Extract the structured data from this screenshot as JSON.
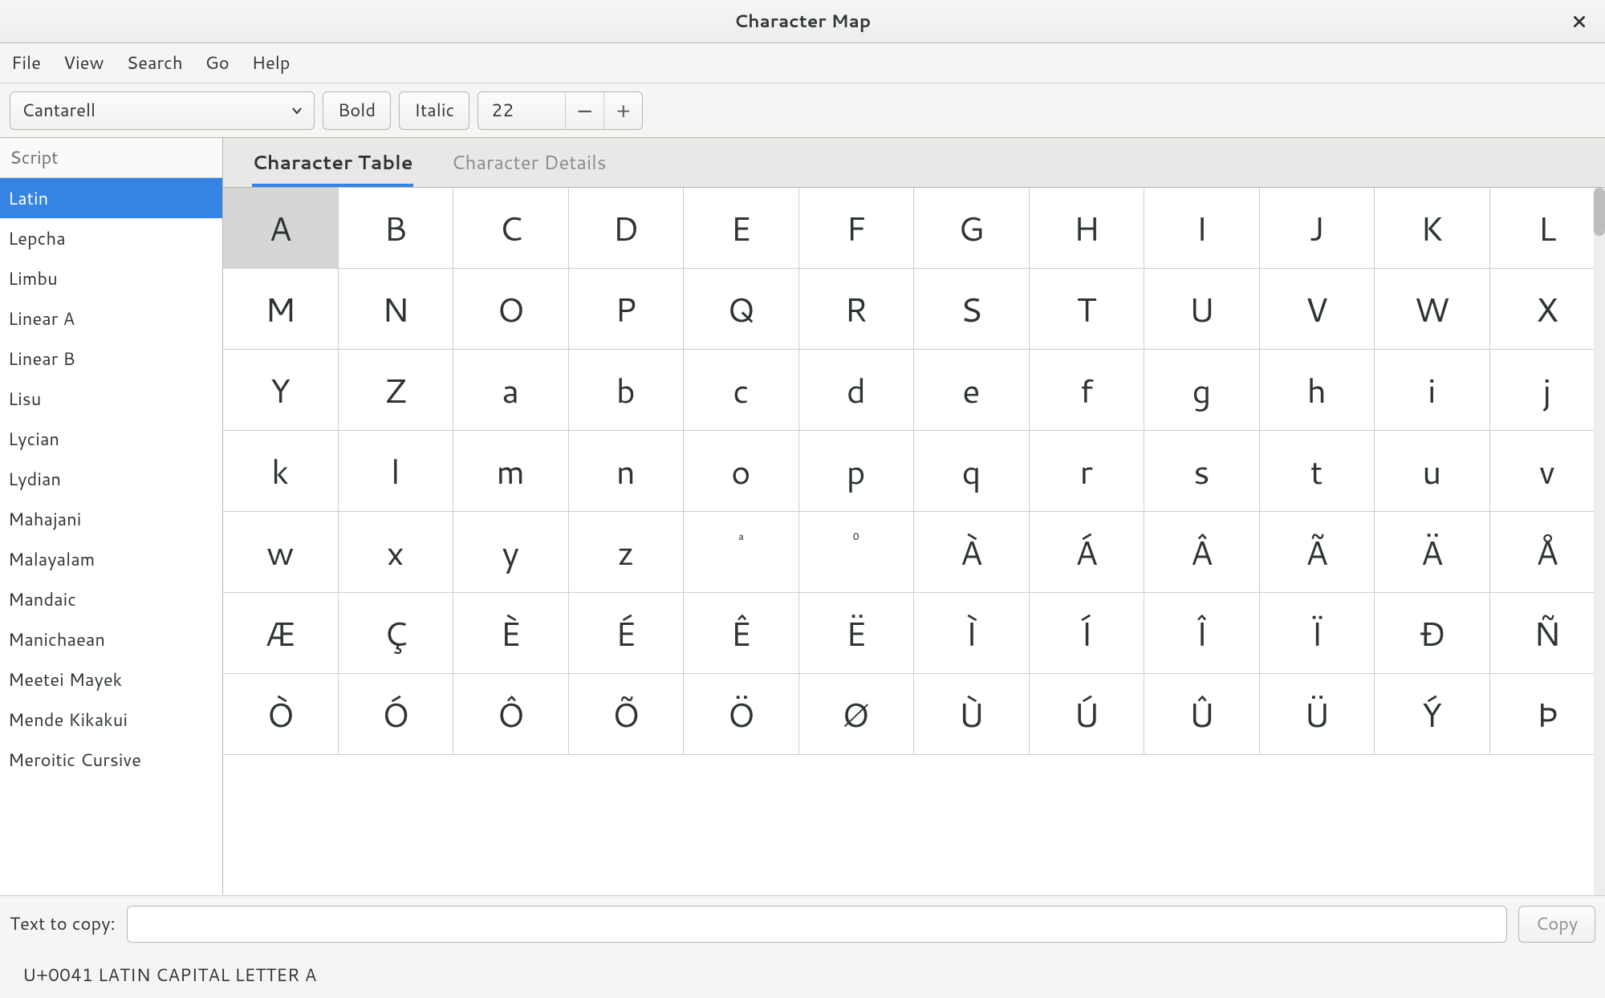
{
  "window": {
    "title": "Character Map"
  },
  "menubar": {
    "items": [
      "File",
      "View",
      "Search",
      "Go",
      "Help"
    ]
  },
  "toolbar": {
    "font": "Cantarell",
    "bold_label": "Bold",
    "italic_label": "Italic",
    "size": "22"
  },
  "sidebar": {
    "header": "Script",
    "selected_index": 0,
    "items": [
      "Latin",
      "Lepcha",
      "Limbu",
      "Linear A",
      "Linear B",
      "Lisu",
      "Lycian",
      "Lydian",
      "Mahajani",
      "Malayalam",
      "Mandaic",
      "Manichaean",
      "Meetei Mayek",
      "Mende Kikakui",
      "Meroitic Cursive"
    ]
  },
  "tabs": {
    "active": 0,
    "labels": [
      "Character Table",
      "Character Details"
    ]
  },
  "grid": {
    "selected_index": 0,
    "cells": [
      "A",
      "B",
      "C",
      "D",
      "E",
      "F",
      "G",
      "H",
      "I",
      "J",
      "K",
      "L",
      "M",
      "N",
      "O",
      "P",
      "Q",
      "R",
      "S",
      "T",
      "U",
      "V",
      "W",
      "X",
      "Y",
      "Z",
      "a",
      "b",
      "c",
      "d",
      "e",
      "f",
      "g",
      "h",
      "i",
      "j",
      "k",
      "l",
      "m",
      "n",
      "o",
      "p",
      "q",
      "r",
      "s",
      "t",
      "u",
      "v",
      "w",
      "x",
      "y",
      "z",
      "ª",
      "º",
      "À",
      "Á",
      "Â",
      "Ã",
      "Ä",
      "Å",
      "Æ",
      "Ç",
      "È",
      "É",
      "Ê",
      "Ë",
      "Ì",
      "Í",
      "Î",
      "Ï",
      "Ð",
      "Ñ",
      "Ò",
      "Ó",
      "Ô",
      "Õ",
      "Ö",
      "Ø",
      "Ù",
      "Ú",
      "Û",
      "Ü",
      "Ý",
      "Þ"
    ],
    "small_indices": [
      52,
      53
    ]
  },
  "copybar": {
    "label": "Text to copy:",
    "value": "",
    "button": "Copy"
  },
  "status": "U+0041 LATIN CAPITAL LETTER A"
}
